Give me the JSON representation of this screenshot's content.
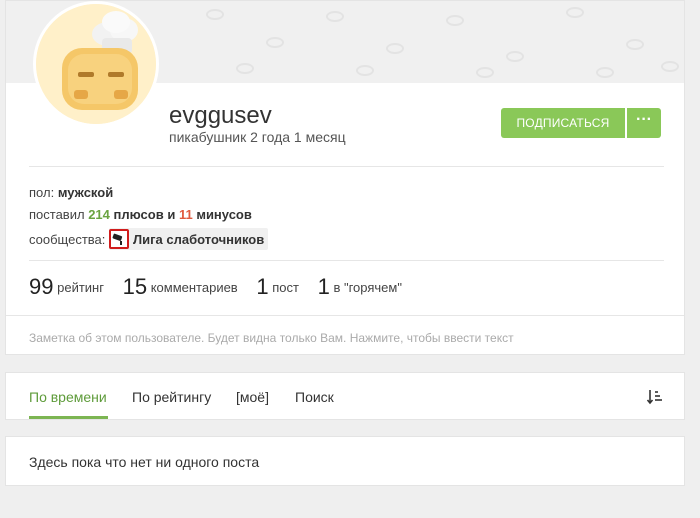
{
  "profile": {
    "username": "evggusev",
    "tenure": "пикабушник 2 года 1 месяц",
    "subscribe_label": "ПОДПИСАТЬСЯ",
    "more_label": "···",
    "gender_label": "пол:",
    "gender_value": "мужской",
    "votes_prefix": "поставил",
    "plus_count": "214",
    "plus_label": "плюсов и",
    "minus_count": "11",
    "minus_label": "минусов",
    "communities_label": "сообщества:",
    "community_name": "Лига слаботочников",
    "stats": [
      {
        "value": "99",
        "label": "рейтинг"
      },
      {
        "value": "15",
        "label": "комментариев"
      },
      {
        "value": "1",
        "label": "пост"
      },
      {
        "value": "1",
        "label": "в \"горячем\""
      }
    ],
    "note_placeholder": "Заметка об этом пользователе. Будет видна только Вам. Нажмите, чтобы ввести текст"
  },
  "tabs": [
    {
      "label": "По времени",
      "active": true
    },
    {
      "label": "По рейтингу",
      "active": false
    },
    {
      "label": "[моё]",
      "active": false
    },
    {
      "label": "Поиск",
      "active": false
    }
  ],
  "sort_icon": "sort-icon",
  "empty_message": "Здесь пока что нет ни одного поста",
  "colors": {
    "accent": "#8ac858",
    "active_tab": "#5e9b3a",
    "minus": "#e0593e",
    "plus": "#6aa341"
  }
}
